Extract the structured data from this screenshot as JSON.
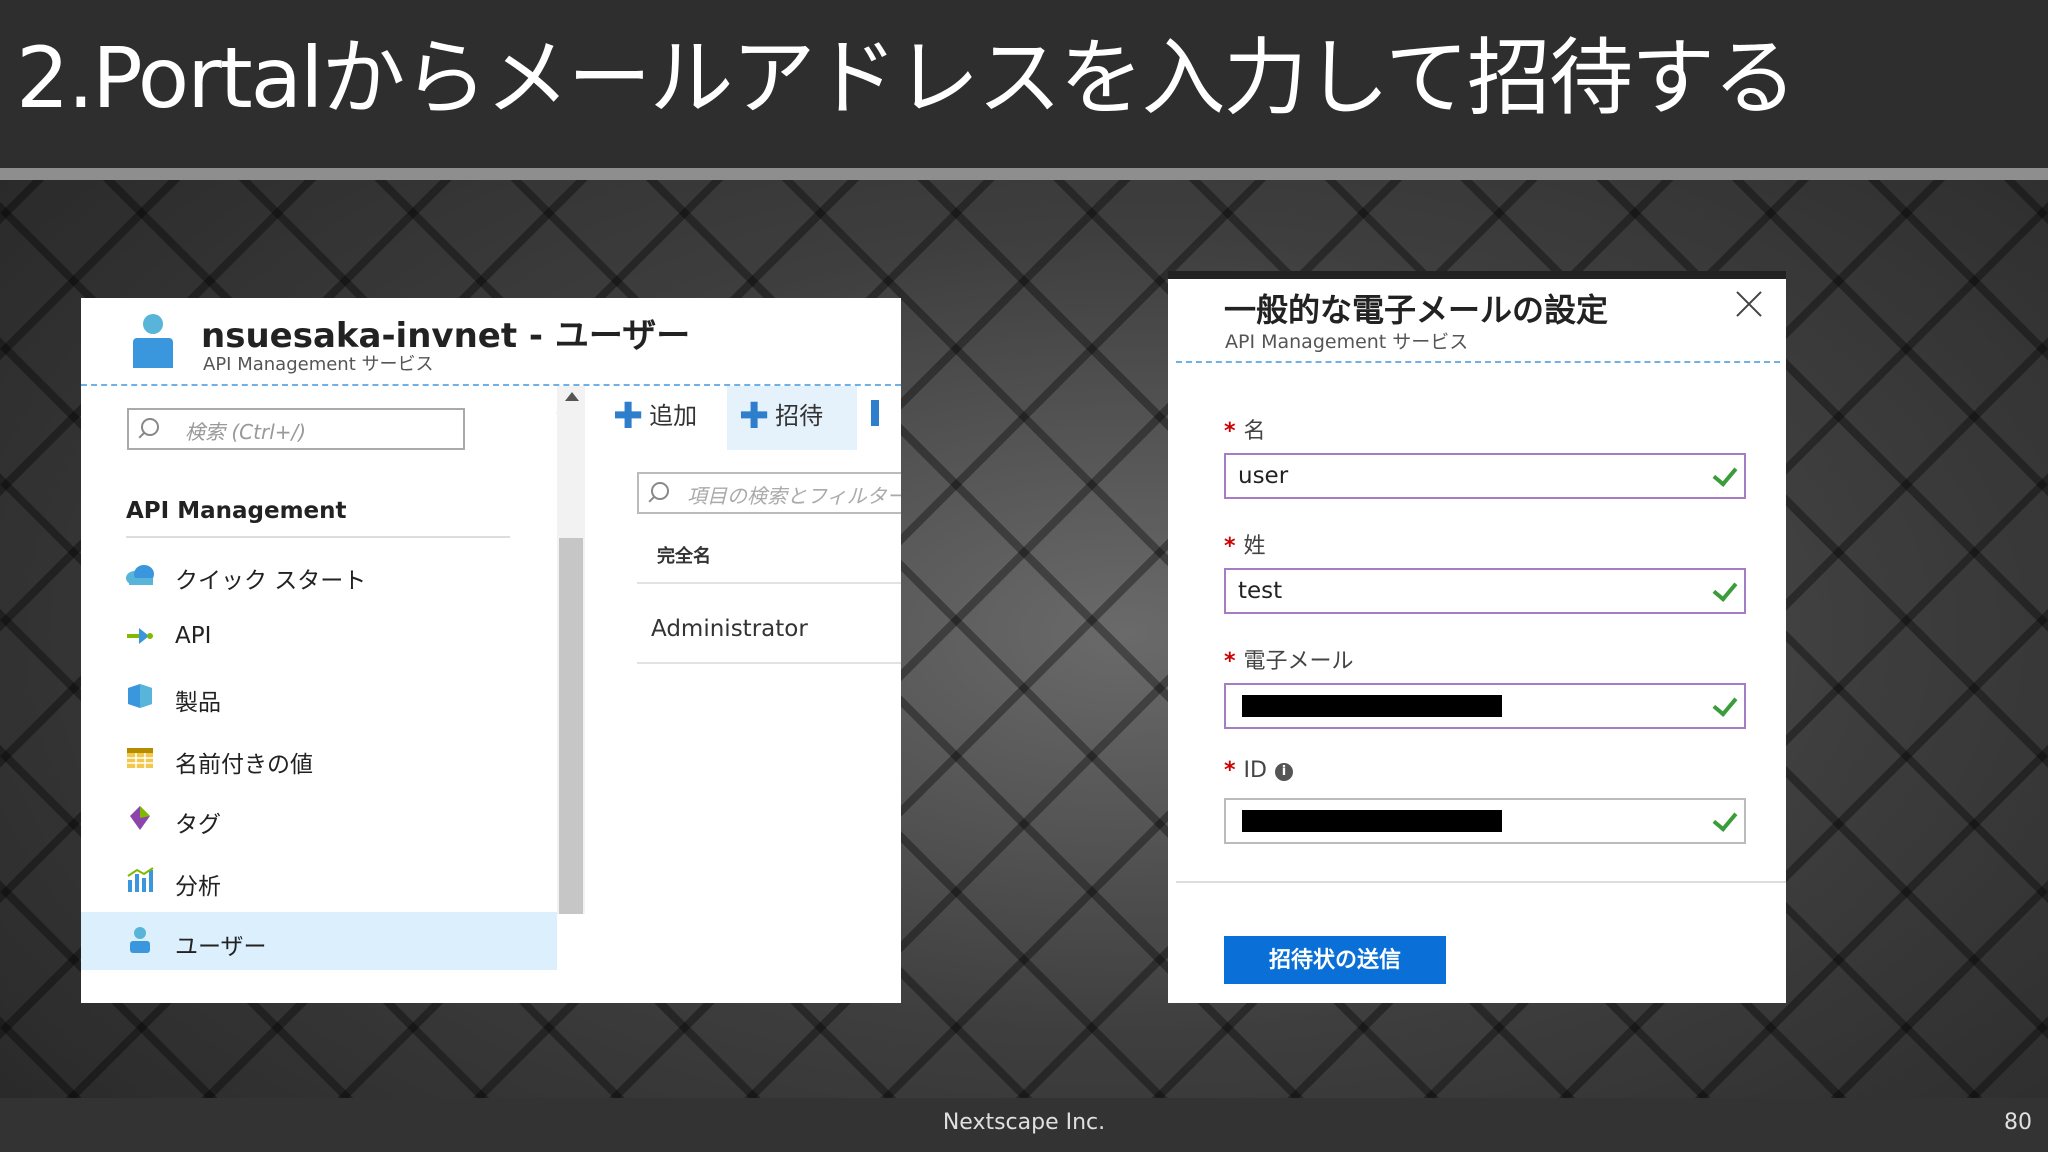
{
  "slide": {
    "title": "2.Portalからメールアドレスを入力して招待する",
    "footer_company": "Nextscape Inc.",
    "page_number": "80"
  },
  "left_panel": {
    "blade_title": "nsuesaka-invnet - ユーザー",
    "blade_subtitle": "API Management サービス",
    "search_placeholder": "検索 (Ctrl+/)",
    "collapse_glyph": "«",
    "section_title": "API Management",
    "nav_items": [
      {
        "label": "クイック スタート",
        "icon": "cloud-icon"
      },
      {
        "label": "API",
        "icon": "api-arrow-icon"
      },
      {
        "label": "製品",
        "icon": "product-box-icon"
      },
      {
        "label": "名前付きの値",
        "icon": "table-icon"
      },
      {
        "label": "タグ",
        "icon": "tag-icon"
      },
      {
        "label": "分析",
        "icon": "analytics-icon"
      },
      {
        "label": "ユーザー",
        "icon": "user-icon",
        "selected": true
      }
    ],
    "toolbar": {
      "add_label": "追加",
      "invite_label": "招待",
      "plus_glyph": "✚"
    },
    "filter_placeholder": "項目の検索とフィルター...",
    "column_header": "完全名",
    "rows": [
      "Administrator"
    ]
  },
  "right_panel": {
    "title": "一般的な電子メールの設定",
    "subtitle": "API Management サービス",
    "required_marker": "*",
    "fields": {
      "first_name": {
        "label": "名",
        "value": "user"
      },
      "last_name": {
        "label": "姓",
        "value": "test"
      },
      "email": {
        "label": "電子メール",
        "value": ""
      },
      "id": {
        "label": "ID",
        "value": ""
      }
    },
    "info_glyph": "i",
    "send_button": "招待状の送信"
  },
  "colors": {
    "accent_blue": "#0a6fd6",
    "selected_row": "#dceffc",
    "field_border": "#a67cc4",
    "valid_check": "#3a9d3a",
    "required_red": "#cc0000"
  }
}
